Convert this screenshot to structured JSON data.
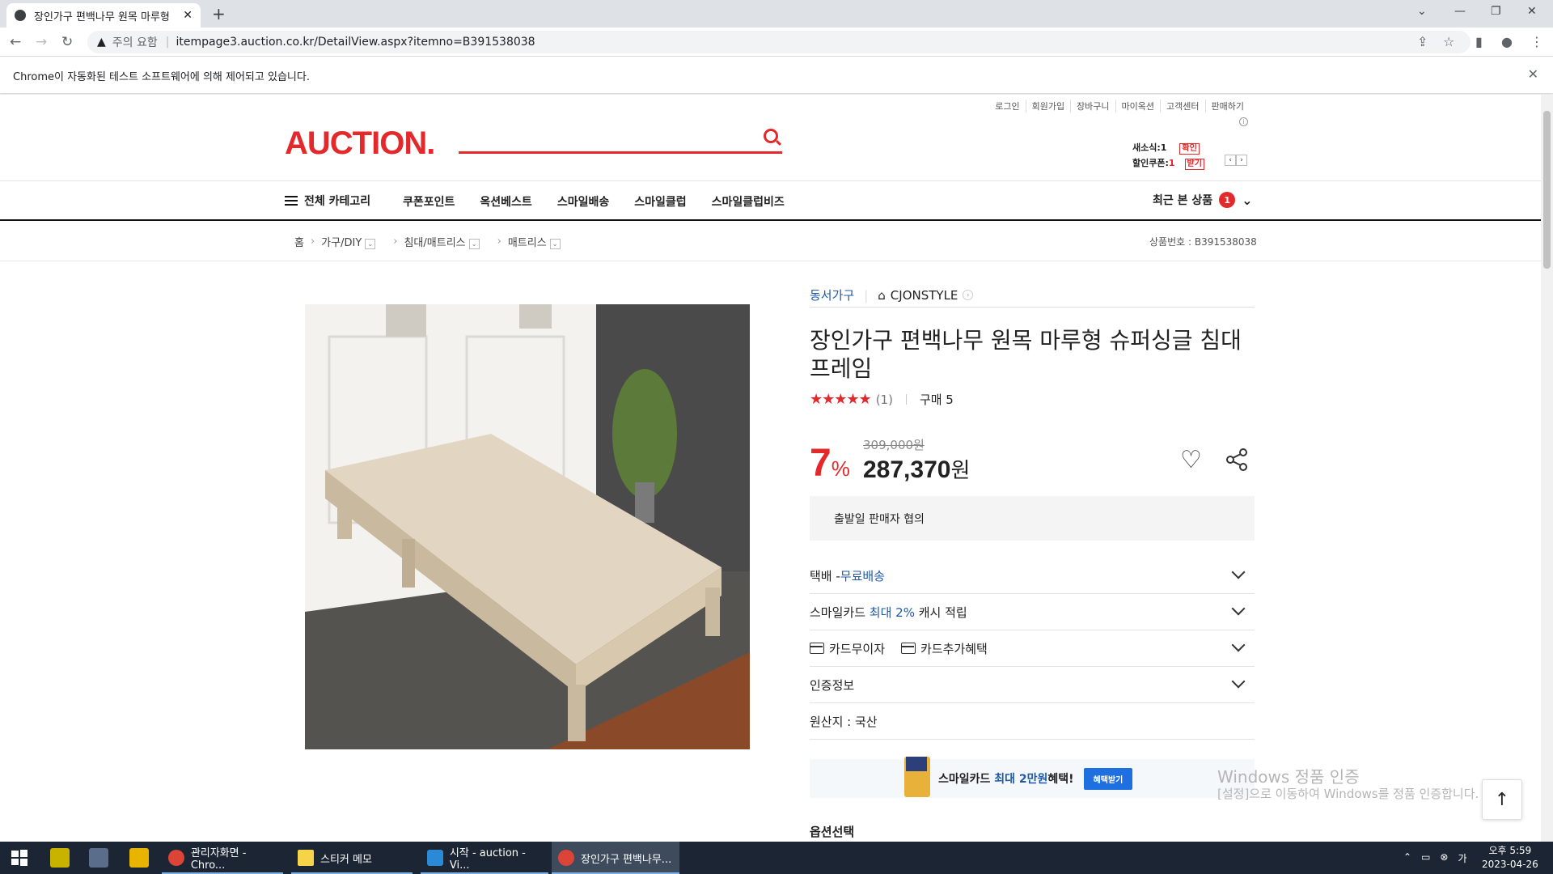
{
  "browser": {
    "tab_title": "장인가구 편백나무 원목 마루형",
    "not_secure_label": "주의 요함",
    "url": "itempage3.auction.co.kr/DetailView.aspx?itemno=B391538038",
    "automation_notice": "Chrome이 자동화된 테스트 소프트웨어에 의해 제어되고 있습니다."
  },
  "header": {
    "top_links": [
      "로그인",
      "회원가입",
      "장바구니",
      "마이옥션",
      "고객센터",
      "판매하기"
    ],
    "logo_text": "AUCTION.",
    "news_label": "새소식:",
    "news_count": "1",
    "news_button": "확인",
    "coupon_label": "할인쿠폰:",
    "coupon_count": "1",
    "coupon_button": "받기"
  },
  "gnb": {
    "category_label": "전체 카테고리",
    "menu": [
      "쿠폰포인트",
      "옥션베스트",
      "스마일배송",
      "스마일클럽",
      "스마일클럽비즈"
    ],
    "recent_label": "최근 본 상품",
    "recent_count": "1"
  },
  "breadcrumb": {
    "home": "홈",
    "level1": "가구/DIY",
    "level2": "침대/매트리스",
    "level3": "매트리스",
    "product_no": "상품번호 : B391538038"
  },
  "product": {
    "shop_name": "동서가구",
    "store_name": "CJONSTYLE",
    "title": "장인가구 편백나무 원목 마루형 슈퍼싱글 침대 프레임",
    "rating_stars": 5,
    "review_count": "(1)",
    "purchase_count": "구매 5",
    "discount_pct": "7",
    "discount_unit": "%",
    "original_price": "309,000원",
    "sale_price": "287,370",
    "price_unit": "원",
    "ship_info": "출발일 판매자 협의",
    "delivery_label": "택배 - ",
    "delivery_value": "무료배송",
    "smilecard_prefix": "스마일카드 ",
    "smilecard_highlight": "최대 2%",
    "smilecard_suffix": " 캐시 적립",
    "card_noint": "카드무이자",
    "card_benefit": "카드추가혜택",
    "cert_label": "인증정보",
    "origin_label": "원산지 : 국산",
    "banner_prefix": "스마일카드 ",
    "banner_highlight": "최대 2만원",
    "banner_suffix": " 혜택!",
    "banner_button": "혜택받기",
    "option_label": "옵션선택"
  },
  "overlay": {
    "watermark_title": "Windows 정품 인증",
    "watermark_sub": "[설정]으로 이동하여 Windows를 정품 인증합니다."
  },
  "taskbar": {
    "apps": [
      "관리자화면 - Chro...",
      "스티커 메모",
      "시작 - auction - Vi...",
      "장인가구 편백나무..."
    ],
    "time": "오후 5:59",
    "date": "2023-04-26"
  },
  "colors": {
    "brand_red": "#e3292c",
    "link_blue": "#1e5aa8",
    "taskbar": "#1c2533"
  }
}
